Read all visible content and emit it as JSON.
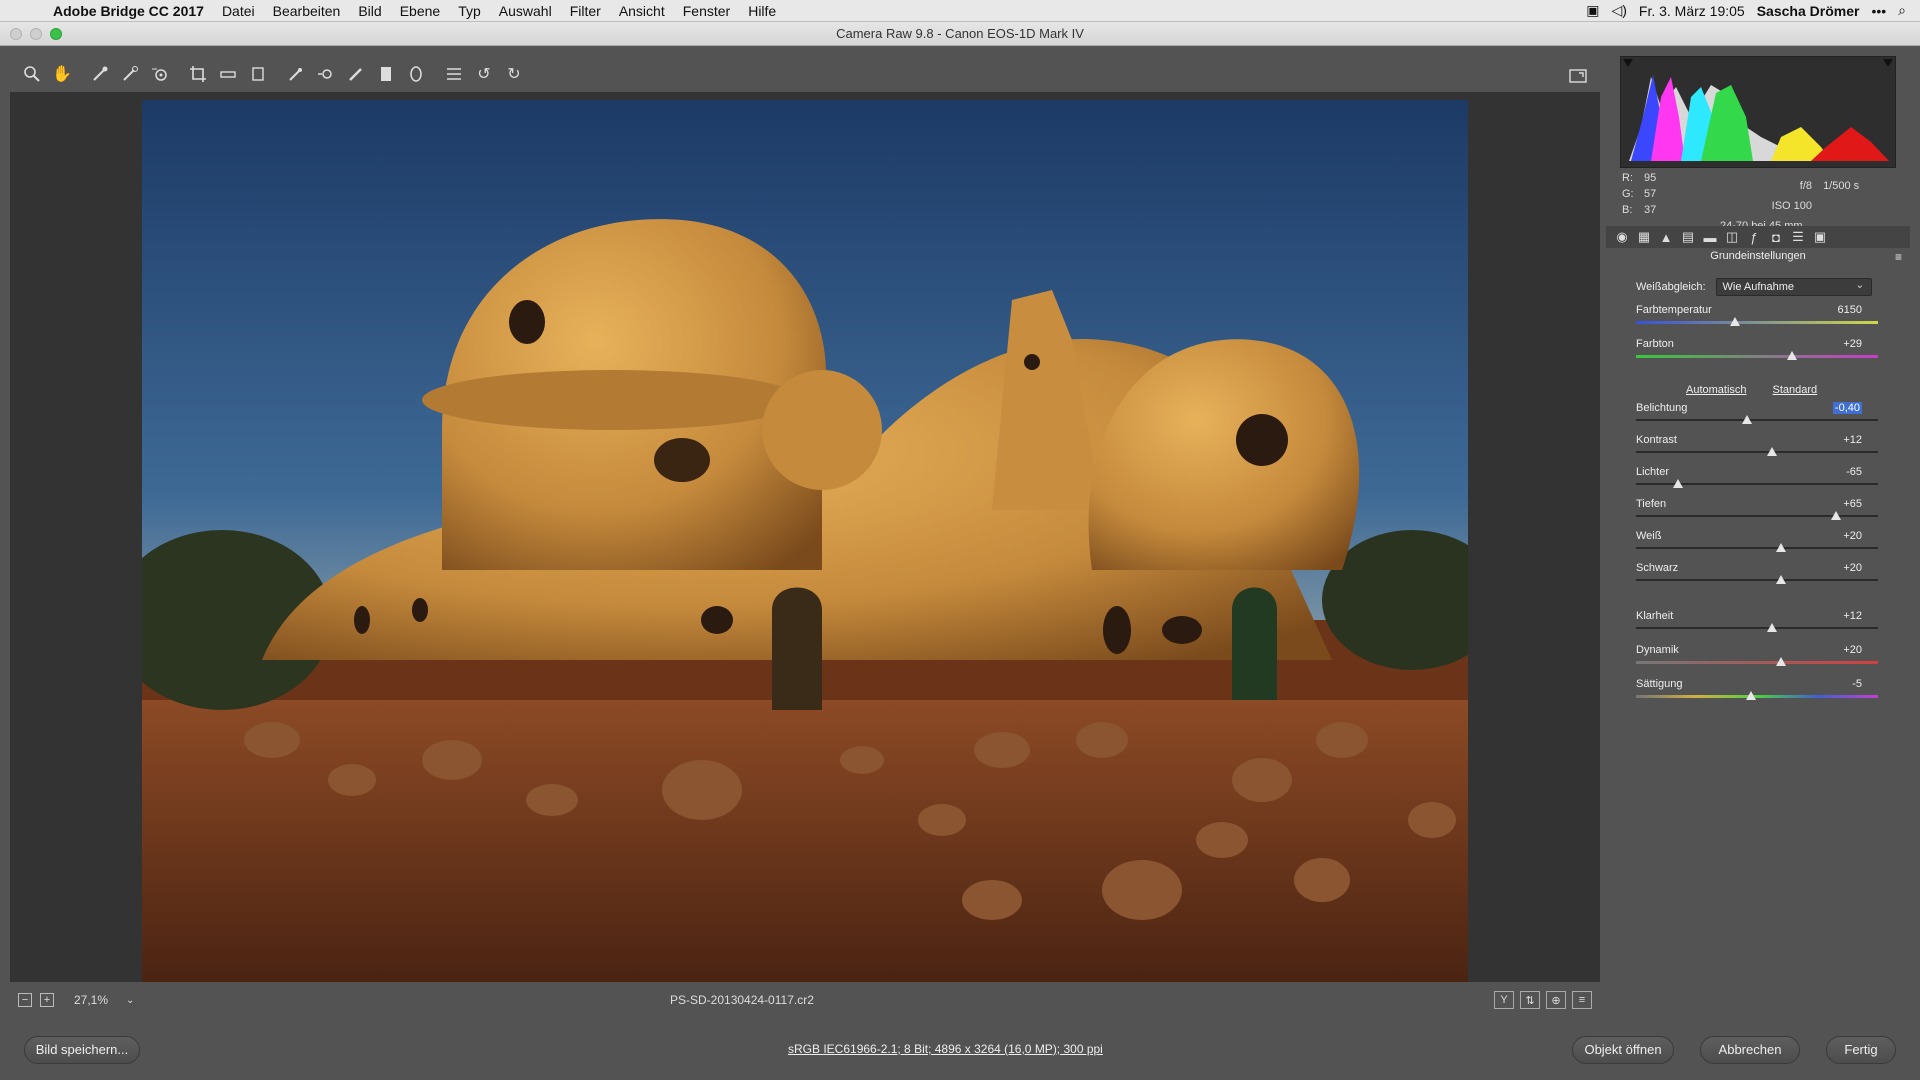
{
  "menubar": {
    "app": "Adobe Bridge CC 2017",
    "items": [
      "Datei",
      "Bearbeiten",
      "Bild",
      "Ebene",
      "Typ",
      "Auswahl",
      "Filter",
      "Ansicht",
      "Fenster",
      "Hilfe"
    ],
    "datetime": "Fr. 3. März 19:05",
    "user": "Sascha Drömer"
  },
  "window": {
    "title": "Camera Raw 9.8  -  Canon EOS-1D Mark IV"
  },
  "statusbar": {
    "zoom": "27,1%",
    "filename": "PS-SD-20130424-0117.cr2"
  },
  "readouts": {
    "r_label": "R:",
    "r": "95",
    "g_label": "G:",
    "g": "57",
    "b_label": "B:",
    "b": "37",
    "aperture": "f/8",
    "shutter": "1/500 s",
    "iso": "ISO 100",
    "lens": "24-70 bei 45 mm"
  },
  "panel": {
    "title": "Grundeinstellungen",
    "wb_label": "Weißabgleich:",
    "wb_value": "Wie Aufnahme",
    "auto_link": "Automatisch",
    "default_link": "Standard",
    "sliders": [
      {
        "label": "Farbtemperatur",
        "value": "6150",
        "pos": 0.41
      },
      {
        "label": "Farbton",
        "value": "+29",
        "pos": 0.645
      },
      {
        "label": "Belichtung",
        "value": "-0,40",
        "pos": 0.46
      },
      {
        "label": "Kontrast",
        "value": "+12",
        "pos": 0.56
      },
      {
        "label": "Lichter",
        "value": "-65",
        "pos": 0.175
      },
      {
        "label": "Tiefen",
        "value": "+65",
        "pos": 0.825
      },
      {
        "label": "Weiß",
        "value": "+20",
        "pos": 0.6
      },
      {
        "label": "Schwarz",
        "value": "+20",
        "pos": 0.6
      },
      {
        "label": "Klarheit",
        "value": "+12",
        "pos": 0.56
      },
      {
        "label": "Dynamik",
        "value": "+20",
        "pos": 0.6
      },
      {
        "label": "Sättigung",
        "value": "-5",
        "pos": 0.475
      }
    ]
  },
  "buttons": {
    "save": "Bild speichern...",
    "workflow": "sRGB IEC61966-2.1; 8 Bit; 4896 x 3264 (16,0 MP); 300 ppi",
    "open": "Objekt öffnen",
    "cancel": "Abbrechen",
    "done": "Fertig"
  }
}
